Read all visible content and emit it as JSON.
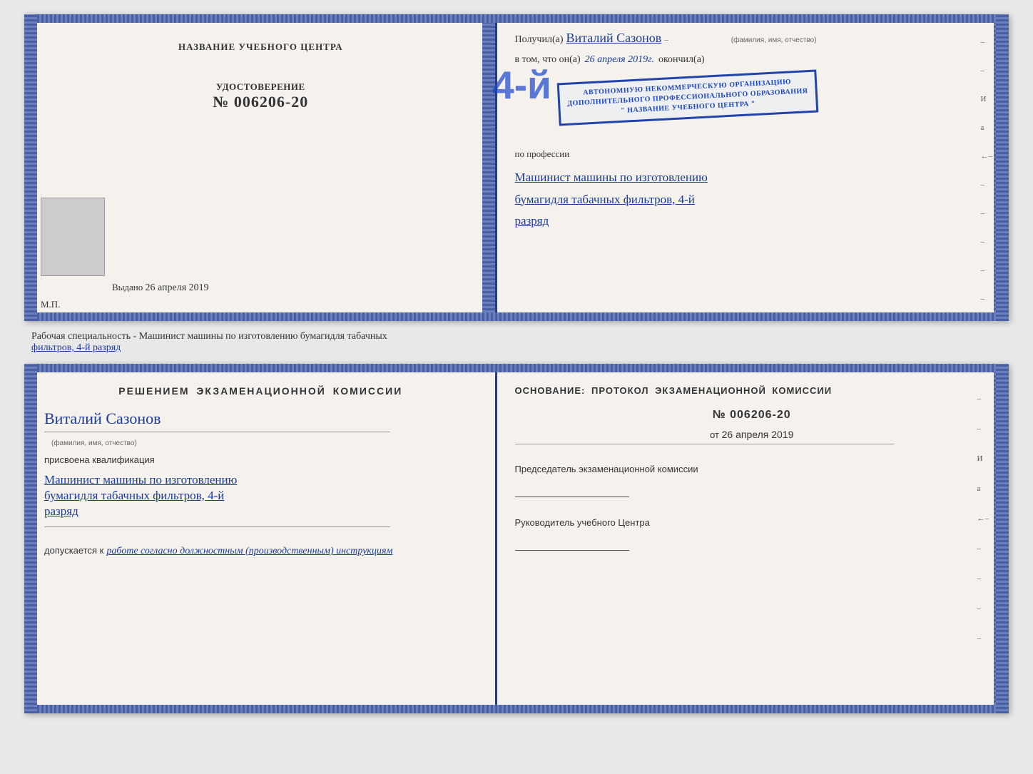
{
  "top_left": {
    "title": "НАЗВАНИЕ УЧЕБНОГО ЦЕНТРА",
    "cert_label": "УДОСТОВЕРЕНИЕ",
    "cert_number": "№ 006206-20",
    "issued_label": "Выдано",
    "issued_date": "26 апреля 2019",
    "mp_label": "М.П."
  },
  "top_right": {
    "received_label": "Получил(а)",
    "recipient_name": "Виталий Сазонов",
    "recipient_hint": "(фамилия, имя, отчество)",
    "tom_label": "в том, что он(а)",
    "date_value": "26 апреля 2019г.",
    "finished_label": "окончил(а)",
    "stamp_line1": "АВТОНОМНУЮ НЕКОММЕРЧЕСКУЮ ОРГАНИЗАЦИЮ",
    "stamp_line2": "ДОПОЛНИТЕЛЬНОГО ПРОФЕССИОНАЛЬНОГО ОБРАЗОВАНИЯ",
    "stamp_line3": "\" НАЗВАНИЕ УЧЕБНОГО ЦЕНТРА \"",
    "profession_label": "по профессии",
    "profession_hw1": "Машинист машины по изготовлению",
    "profession_hw2": "бумагидля табачных фильтров, 4-й",
    "profession_hw3": "разряд",
    "side_dashes": [
      "-",
      "-",
      "И",
      "а",
      "←",
      "-",
      "-",
      "-",
      "-",
      "-"
    ]
  },
  "info_bar": {
    "text": "Рабочая специальность - Машинист машины по изготовлению бумагидля табачных",
    "text2": "фильтров, 4-й разряд"
  },
  "bottom_left": {
    "decision_title": "Решением экзаменационной комиссии",
    "name_hw": "Виталий Сазонов",
    "name_hint": "(фамилия, имя, отчество)",
    "assigned_label": "присвоена квалификация",
    "qual_hw1": "Машинист машины по изготовлению",
    "qual_hw2": "бумагидля табачных фильтров, 4-й",
    "qual_hw3": "разряд",
    "allows_label": "допускается к",
    "allows_hw": "работе согласно должностным (производственным) инструкциям"
  },
  "bottom_right": {
    "basis_title": "Основание: протокол экзаменационной комиссии",
    "protocol_number": "№ 006206-20",
    "from_label": "от",
    "from_date": "26 апреля 2019",
    "chairman_label": "Председатель экзаменационной комиссии",
    "director_label": "Руководитель учебного Центра",
    "side_dashes": [
      "-",
      "-",
      "И",
      "а",
      "←",
      "-",
      "-",
      "-",
      "-"
    ]
  }
}
